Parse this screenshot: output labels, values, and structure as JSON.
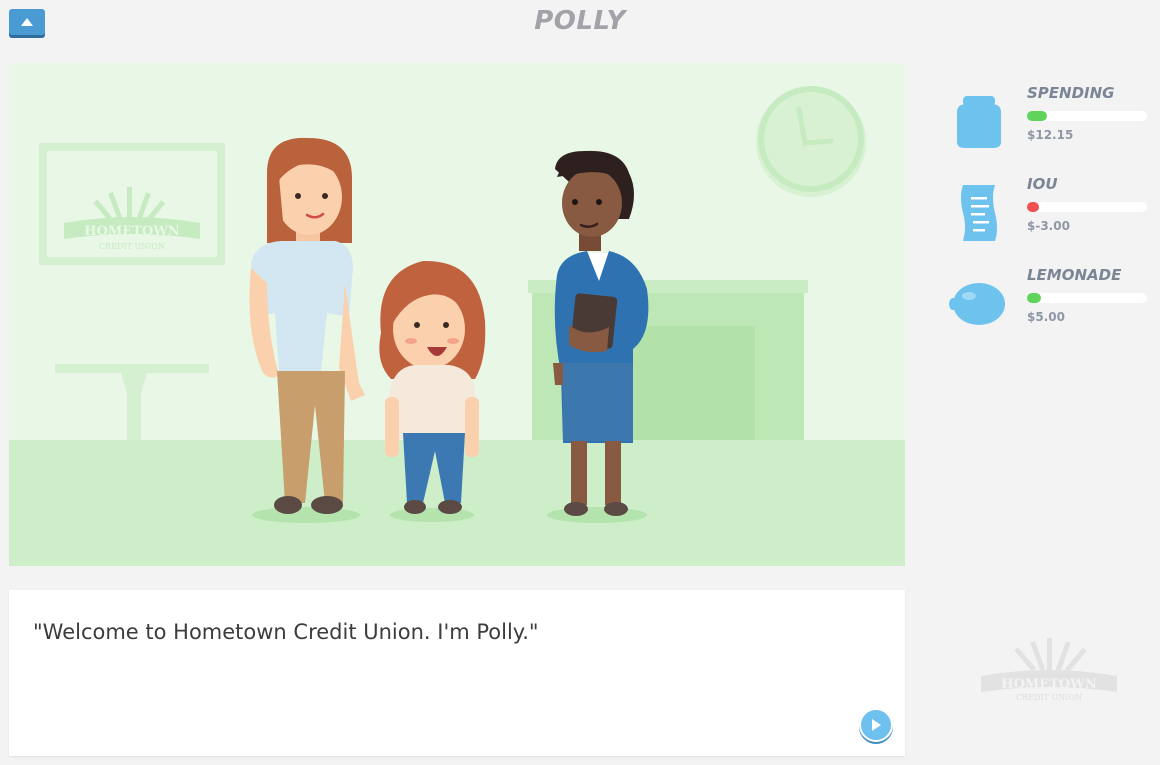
{
  "header": {
    "title": "POLLY",
    "menu_icon": "chevron-up-icon"
  },
  "scene": {
    "sign_text_line1": "HOMETOWN",
    "sign_text_line2": "CREDIT UNION"
  },
  "dialog": {
    "text": "\"Welcome to Hometown Credit Union. I'm Polly.\"",
    "play_icon": "play-icon"
  },
  "stats": [
    {
      "label": "SPENDING",
      "value": "$12.15",
      "level": 0.17,
      "color": "#5fd35a",
      "icon": "jar-icon"
    },
    {
      "label": "IOU",
      "value": "$-3.00",
      "level": 0.1,
      "color": "#f05050",
      "icon": "receipt-icon"
    },
    {
      "label": "LEMONADE",
      "value": "$5.00",
      "level": 0.12,
      "color": "#5fd35a",
      "icon": "lemon-icon"
    }
  ],
  "watermark": {
    "line1": "HOMETOWN",
    "line2": "CREDIT UNION"
  }
}
